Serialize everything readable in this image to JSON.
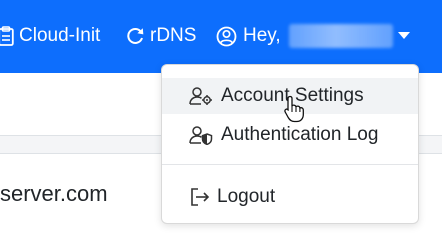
{
  "navbar": {
    "items": [
      {
        "label": "Cloud-Init",
        "icon": "clipboard-icon"
      },
      {
        "label": "rDNS",
        "icon": "refresh-icon"
      },
      {
        "label": "Hey,",
        "icon": "user-circle-icon"
      }
    ],
    "user_name_masked": true,
    "accent_color": "#0d6efd"
  },
  "content": {
    "server_text": "server.com"
  },
  "user_menu": {
    "items": [
      {
        "label": "Account Settings",
        "icon": "user-gear-icon"
      },
      {
        "label": "Authentication Log",
        "icon": "user-shield-icon"
      },
      {
        "label": "Logout",
        "icon": "logout-icon"
      }
    ]
  },
  "cursor": {
    "icon": "hand-pointer-icon"
  }
}
